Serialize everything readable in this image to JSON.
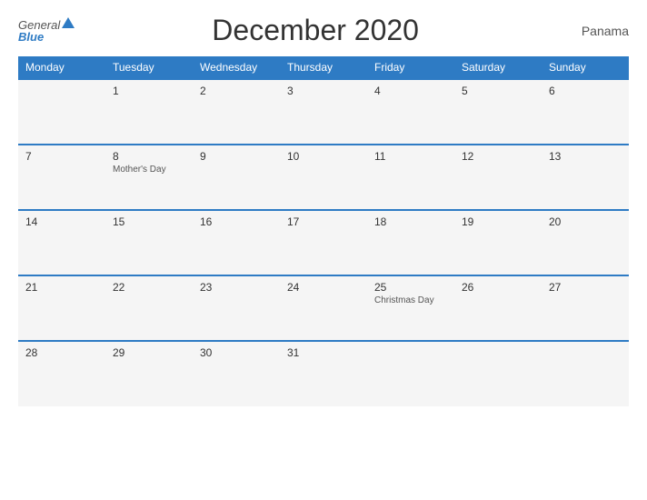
{
  "header": {
    "logo_general": "General",
    "logo_blue": "Blue",
    "title": "December 2020",
    "country": "Panama"
  },
  "days_header": [
    "Monday",
    "Tuesday",
    "Wednesday",
    "Thursday",
    "Friday",
    "Saturday",
    "Sunday"
  ],
  "weeks": [
    [
      {
        "day": "",
        "event": ""
      },
      {
        "day": "1",
        "event": ""
      },
      {
        "day": "2",
        "event": ""
      },
      {
        "day": "3",
        "event": ""
      },
      {
        "day": "4",
        "event": ""
      },
      {
        "day": "5",
        "event": ""
      },
      {
        "day": "6",
        "event": ""
      }
    ],
    [
      {
        "day": "7",
        "event": ""
      },
      {
        "day": "8",
        "event": "Mother's Day"
      },
      {
        "day": "9",
        "event": ""
      },
      {
        "day": "10",
        "event": ""
      },
      {
        "day": "11",
        "event": ""
      },
      {
        "day": "12",
        "event": ""
      },
      {
        "day": "13",
        "event": ""
      }
    ],
    [
      {
        "day": "14",
        "event": ""
      },
      {
        "day": "15",
        "event": ""
      },
      {
        "day": "16",
        "event": ""
      },
      {
        "day": "17",
        "event": ""
      },
      {
        "day": "18",
        "event": ""
      },
      {
        "day": "19",
        "event": ""
      },
      {
        "day": "20",
        "event": ""
      }
    ],
    [
      {
        "day": "21",
        "event": ""
      },
      {
        "day": "22",
        "event": ""
      },
      {
        "day": "23",
        "event": ""
      },
      {
        "day": "24",
        "event": ""
      },
      {
        "day": "25",
        "event": "Christmas Day"
      },
      {
        "day": "26",
        "event": ""
      },
      {
        "day": "27",
        "event": ""
      }
    ],
    [
      {
        "day": "28",
        "event": ""
      },
      {
        "day": "29",
        "event": ""
      },
      {
        "day": "30",
        "event": ""
      },
      {
        "day": "31",
        "event": ""
      },
      {
        "day": "",
        "event": ""
      },
      {
        "day": "",
        "event": ""
      },
      {
        "day": "",
        "event": ""
      }
    ]
  ]
}
